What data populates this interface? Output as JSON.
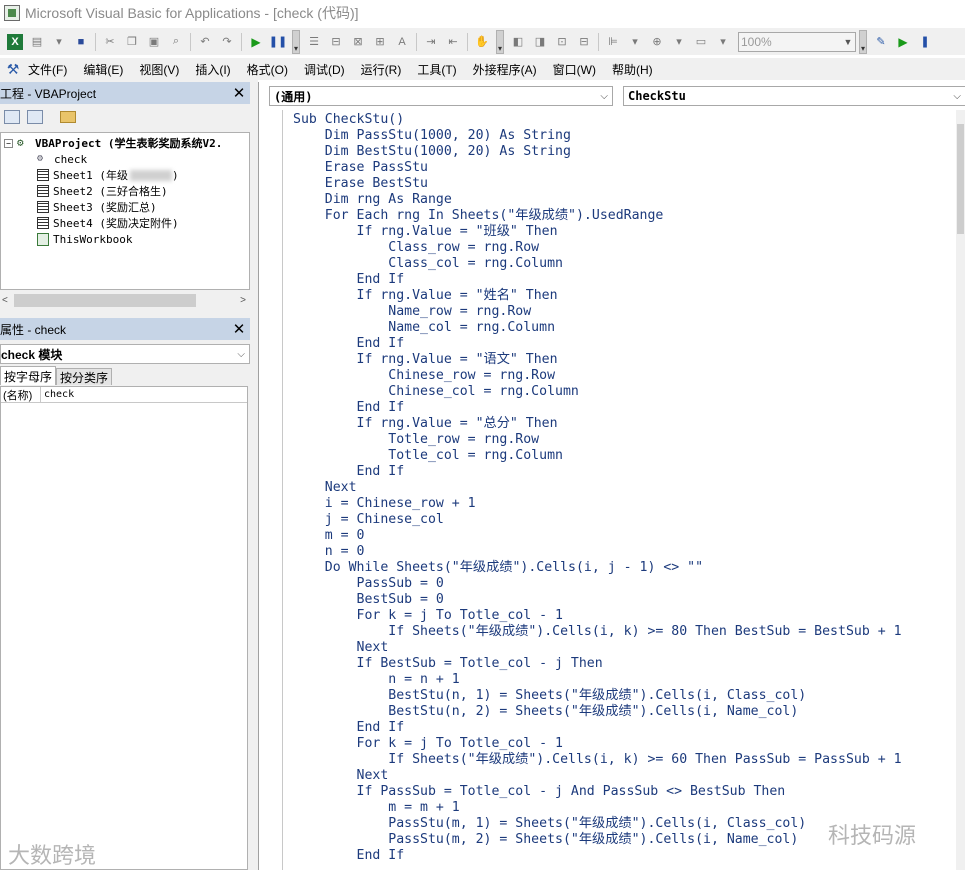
{
  "window": {
    "title": "Microsoft Visual Basic for Applications - [check (代码)]",
    "icon": "vba-app-icon"
  },
  "toolbar": {
    "zoom_value": "100%"
  },
  "menu": {
    "items": [
      "文件(F)",
      "编辑(E)",
      "视图(V)",
      "插入(I)",
      "格式(O)",
      "调试(D)",
      "运行(R)",
      "工具(T)",
      "外接程序(A)",
      "窗口(W)",
      "帮助(H)"
    ]
  },
  "project_panel": {
    "title": "工程 - VBAProject",
    "close_glyph": "✕",
    "root": "VBAProject (学生表彰奖励系统V2.",
    "items": [
      "check",
      "Sheet1 (年级",
      "Sheet2 (三好合格生)",
      "Sheet3 (奖励汇总)",
      "Sheet4 (奖励决定附件)",
      "ThisWorkbook"
    ]
  },
  "properties_panel": {
    "title": "属性 - check",
    "close_glyph": "✕",
    "object_select": "check 模块",
    "tabs": [
      "按字母序",
      "按分类序"
    ],
    "row_key": "(名称)",
    "row_value": "check"
  },
  "code_window": {
    "object_combo": "(通用)",
    "procedure_combo": "CheckStu",
    "lines": [
      "Sub CheckStu()",
      "    Dim PassStu(1000, 20) As String",
      "    Dim BestStu(1000, 20) As String",
      "    Erase PassStu",
      "    Erase BestStu",
      "    Dim rng As Range",
      "    For Each rng In Sheets(\"年级成绩\").UsedRange",
      "        If rng.Value = \"班级\" Then",
      "            Class_row = rng.Row",
      "            Class_col = rng.Column",
      "        End If",
      "        If rng.Value = \"姓名\" Then",
      "            Name_row = rng.Row",
      "            Name_col = rng.Column",
      "        End If",
      "        If rng.Value = \"语文\" Then",
      "            Chinese_row = rng.Row",
      "            Chinese_col = rng.Column",
      "        End If",
      "        If rng.Value = \"总分\" Then",
      "            Totle_row = rng.Row",
      "            Totle_col = rng.Column",
      "        End If",
      "    Next",
      "    i = Chinese_row + 1",
      "    j = Chinese_col",
      "    m = 0",
      "    n = 0",
      "    Do While Sheets(\"年级成绩\").Cells(i, j - 1) <> \"\"",
      "        PassSub = 0",
      "        BestSub = 0",
      "        For k = j To Totle_col - 1",
      "            If Sheets(\"年级成绩\").Cells(i, k) >= 80 Then BestSub = BestSub + 1",
      "        Next",
      "        If BestSub = Totle_col - j Then",
      "            n = n + 1",
      "            BestStu(n, 1) = Sheets(\"年级成绩\").Cells(i, Class_col)",
      "            BestStu(n, 2) = Sheets(\"年级成绩\").Cells(i, Name_col)",
      "        End If",
      "        For k = j To Totle_col - 1",
      "            If Sheets(\"年级成绩\").Cells(i, k) >= 60 Then PassSub = PassSub + 1",
      "        Next",
      "        If PassSub = Totle_col - j And PassSub <> BestSub Then",
      "            m = m + 1",
      "            PassStu(m, 1) = Sheets(\"年级成绩\").Cells(i, Class_col)",
      "            PassStu(m, 2) = Sheets(\"年级成绩\").Cells(i, Name_col)",
      "        End If"
    ]
  },
  "watermarks": {
    "left": "大数跨境",
    "right": "科技码源"
  }
}
